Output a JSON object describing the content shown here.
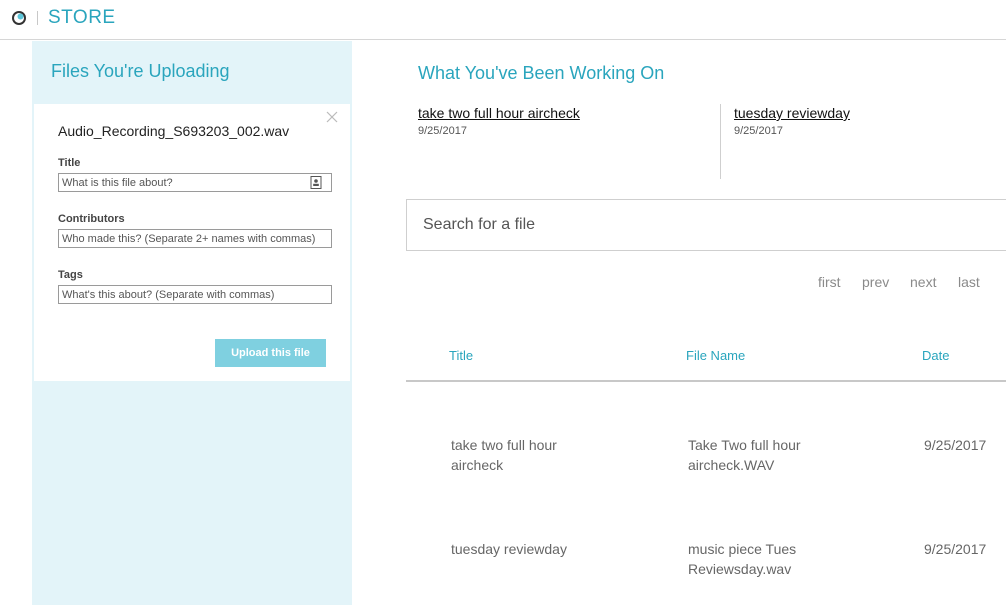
{
  "header": {
    "brand": "STORE"
  },
  "uploads": {
    "title": "Files You're Uploading",
    "file_name": "Audio_Recording_S693203_002.wav",
    "fields": {
      "title_label": "Title",
      "title_placeholder": "What is this file about?",
      "contributors_label": "Contributors",
      "contributors_placeholder": "Who made this? (Separate 2+ names with commas)",
      "tags_label": "Tags",
      "tags_placeholder": "What's this about? (Separate with commas)"
    },
    "upload_button": "Upload this file"
  },
  "working_on": {
    "title": "What You've Been Working On",
    "items": [
      {
        "title": "take two full hour aircheck",
        "date": "9/25/2017"
      },
      {
        "title": "tuesday reviewday",
        "date": "9/25/2017"
      }
    ]
  },
  "search": {
    "placeholder": "Search for a file"
  },
  "pager": {
    "first": "first",
    "prev": "prev",
    "next": "next",
    "last": "last"
  },
  "table": {
    "columns": [
      "Title",
      "File Name",
      "Date"
    ],
    "rows": [
      {
        "title_line1": "take two full hour",
        "title_line2": "aircheck",
        "file_line1": "Take Two full hour",
        "file_line2": "aircheck.WAV",
        "date": "9/25/2017"
      },
      {
        "title_line1": "tuesday reviewday",
        "title_line2": "",
        "file_line1": "music piece Tues",
        "file_line2": "Reviewsday.wav",
        "date": "9/25/2017"
      }
    ]
  },
  "colors": {
    "accent": "#2aa5bd",
    "panel_bg": "#e3f4f9",
    "button_bg": "#7fd0e0"
  }
}
